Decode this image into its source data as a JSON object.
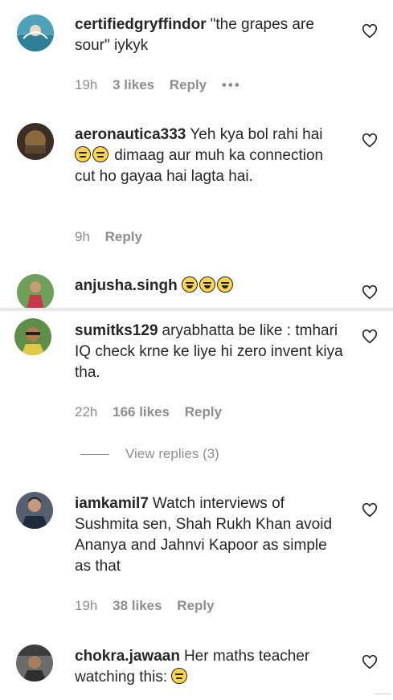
{
  "comments": [
    {
      "username": "certifiedgryffindor",
      "text": "\"the grapes are sour\" iykyk",
      "time": "19h",
      "likes": "3 likes",
      "reply": "Reply",
      "more": "•••"
    },
    {
      "username": "aeronautica333",
      "text_before": "Yeh kya bol rahi hai",
      "text_after": "dimaag aur muh ka connection cut ho gayaa hai lagta hai.",
      "time": "9h",
      "reply": "Reply"
    },
    {
      "username": "anjusha.singh"
    },
    {
      "username": "sumitks129",
      "text": "aryabhatta be like : tmhari IQ check krne ke liye hi zero invent kiya tha.",
      "time": "22h",
      "likes": "166 likes",
      "reply": "Reply",
      "view_replies": "View replies (3)"
    },
    {
      "username": "iamkamil7",
      "text": "Watch interviews of Sushmita sen, Shah Rukh Khan avoid Ananya and Jahnvi Kapoor as simple as that",
      "time": "19h",
      "likes": "38 likes",
      "reply": "Reply"
    },
    {
      "username": "chokra.jawaan",
      "text": "Her maths teacher watching this:"
    }
  ],
  "icons": {
    "like": "heart-outline-icon",
    "emoji_expressionless": "expressionless-face-emoji",
    "emoji_laughing": "grinning-squinting-face-emoji"
  },
  "colors": {
    "text": "#262626",
    "secondary": "#8e8e8e",
    "divider": "#e6e6e6"
  }
}
